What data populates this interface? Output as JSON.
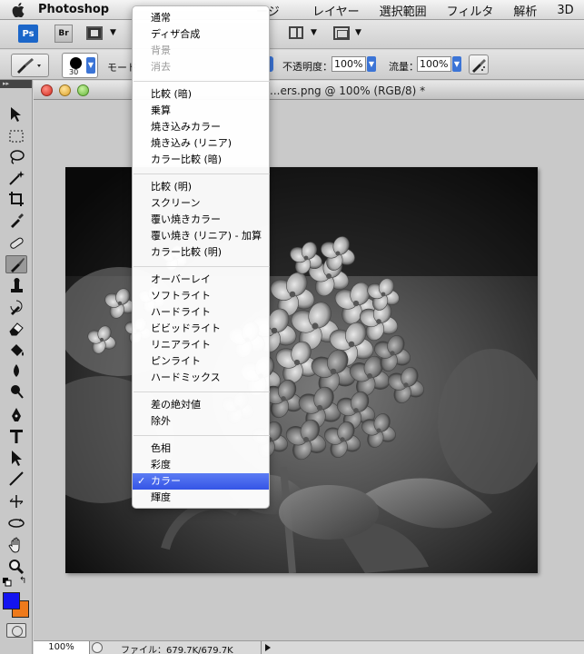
{
  "menubar": {
    "app_name": "Photoshop",
    "items": [
      "レイヤー",
      "選択範囲",
      "フィルタ",
      "解析",
      "3D"
    ],
    "partial_items": [
      "ージ"
    ]
  },
  "appbar": {
    "ps_label": "Ps",
    "br_label": "Br"
  },
  "options": {
    "mode_label": "モード",
    "opacity_label": "不透明度：",
    "opacity_value": "100%",
    "flow_label": "流量：",
    "flow_value": "100%",
    "brush_size": "30"
  },
  "document": {
    "title": "...ers.png @ 100% (RGB/8) *"
  },
  "status": {
    "zoom": "100%",
    "file_info": "ファイル：679.7K/679.7K"
  },
  "blend_menu": {
    "groups": [
      [
        {
          "label": "通常",
          "disabled": false
        },
        {
          "label": "ディザ合成",
          "disabled": false
        },
        {
          "label": "背景",
          "disabled": true
        },
        {
          "label": "消去",
          "disabled": true
        }
      ],
      [
        {
          "label": "比較 (暗)"
        },
        {
          "label": "乗算"
        },
        {
          "label": "焼き込みカラー"
        },
        {
          "label": "焼き込み (リニア)"
        },
        {
          "label": "カラー比較 (暗)"
        }
      ],
      [
        {
          "label": "比較 (明)"
        },
        {
          "label": "スクリーン"
        },
        {
          "label": "覆い焼きカラー"
        },
        {
          "label": "覆い焼き (リニア) - 加算"
        },
        {
          "label": "カラー比較 (明)"
        }
      ],
      [
        {
          "label": "オーバーレイ"
        },
        {
          "label": "ソフトライト"
        },
        {
          "label": "ハードライト"
        },
        {
          "label": "ビビッドライト"
        },
        {
          "label": "リニアライト"
        },
        {
          "label": "ピンライト"
        },
        {
          "label": "ハードミックス"
        }
      ],
      [
        {
          "label": "差の絶対値"
        },
        {
          "label": "除外"
        }
      ],
      [
        {
          "label": "色相"
        },
        {
          "label": "彩度"
        },
        {
          "label": "カラー",
          "selected": true
        },
        {
          "label": "輝度"
        }
      ]
    ],
    "check_mark": "✓"
  },
  "colors": {
    "foreground": "#1414f0",
    "background": "#ee7a1c",
    "menu_highlight": "#3f5ee8"
  },
  "toolbox": {
    "tools": [
      "move-tool",
      "marquee-tool",
      "lasso-tool",
      "magic-wand-tool",
      "crop-tool",
      "eyedropper-tool",
      "healing-brush-tool",
      "brush-tool",
      "clone-stamp-tool",
      "history-brush-tool",
      "eraser-tool",
      "paint-bucket-tool",
      "blur-tool",
      "dodge-tool",
      "pen-tool",
      "type-tool",
      "path-selection-tool",
      "line-tool",
      "3d-rotate-tool",
      "3d-orbit-tool",
      "hand-tool",
      "zoom-tool"
    ]
  }
}
